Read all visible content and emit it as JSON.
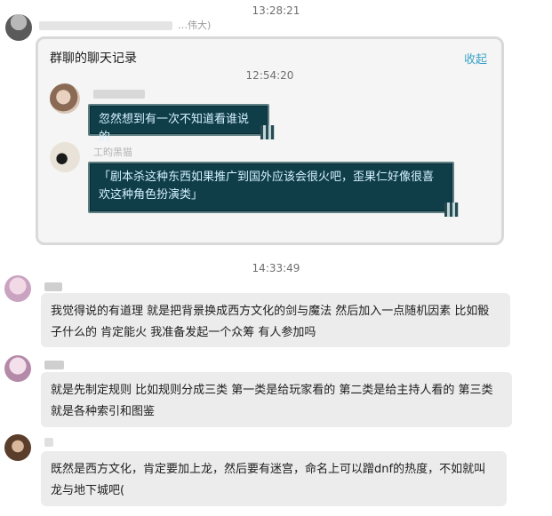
{
  "top": {
    "timestamp": "13:28:21",
    "sender_suffix": "…伟大)"
  },
  "record": {
    "title": "群聊的聊天记录",
    "collapse_label": "收起",
    "time": "12:54:20",
    "messages": [
      {
        "text": "忽然想到有一次不知道看谁说的"
      },
      {
        "sender_fragment": "工昀黑猫",
        "text": "「剧本杀这种东西如果推广到国外应该会很火吧，歪果仁好像很喜欢这种角色扮演类」"
      }
    ]
  },
  "chat": {
    "timestamp": "14:33:49",
    "messages": [
      {
        "text": "我觉得说的有道理 就是把背景换成西方文化的剑与魔法 然后加入一点随机因素 比如骰子什么的 肯定能火 我准备发起一个众筹 有人参加吗"
      },
      {
        "text": "就是先制定规则 比如规则分成三类 第一类是给玩家看的 第二类是给主持人看的 第三类就是各种索引和图鉴"
      },
      {
        "text": "既然是西方文化，肯定要加上龙，然后要有迷宫，命名上可以蹭dnf的热度，不如就叫龙与地下城吧("
      }
    ]
  },
  "colors": {
    "bubble_bg": "#ececec",
    "teal_bg": "#0f3e48",
    "teal_text": "#d6f1ff",
    "link": "#3aa3c5"
  }
}
